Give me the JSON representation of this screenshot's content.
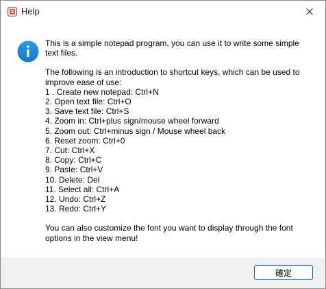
{
  "window": {
    "title": "Help",
    "icon": "notepad-app-icon",
    "close_icon": "close-icon"
  },
  "dialog": {
    "icon": "info-icon",
    "icon_color": "#1a8bd6",
    "intro": [
      "This is a simple notepad program, you can use it to write some simple",
      "text files."
    ],
    "shortcuts_intro": [
      "The following is an introduction to shortcut keys, which can be used to",
      "improve ease of use:"
    ],
    "shortcuts": [
      "1 . Create new notepad: Ctrl+N",
      "2. Open text file: Ctrl+O",
      "3. Save text file: Ctrl+S",
      "4. Zoom in: Ctrl+plus sign/mouse wheel forward",
      "5. Zoom out: Ctrl+minus sign / Mouse wheel back",
      "6. Reset zoom: Ctrl+0",
      "7. Cut: Ctrl+X",
      "8. Copy: Ctrl+C",
      "9. Paste: Ctrl+V",
      "10. Delete: Del",
      "11. Select all: Ctrl+A",
      "12. Undo: Ctrl+Z",
      "13. Redo: Ctrl+Y"
    ],
    "outro": [
      "You can also customize the font you want to display through the font",
      "options in the view menu!"
    ]
  },
  "footer": {
    "ok_label": "確定",
    "accent": "#0067c0"
  }
}
